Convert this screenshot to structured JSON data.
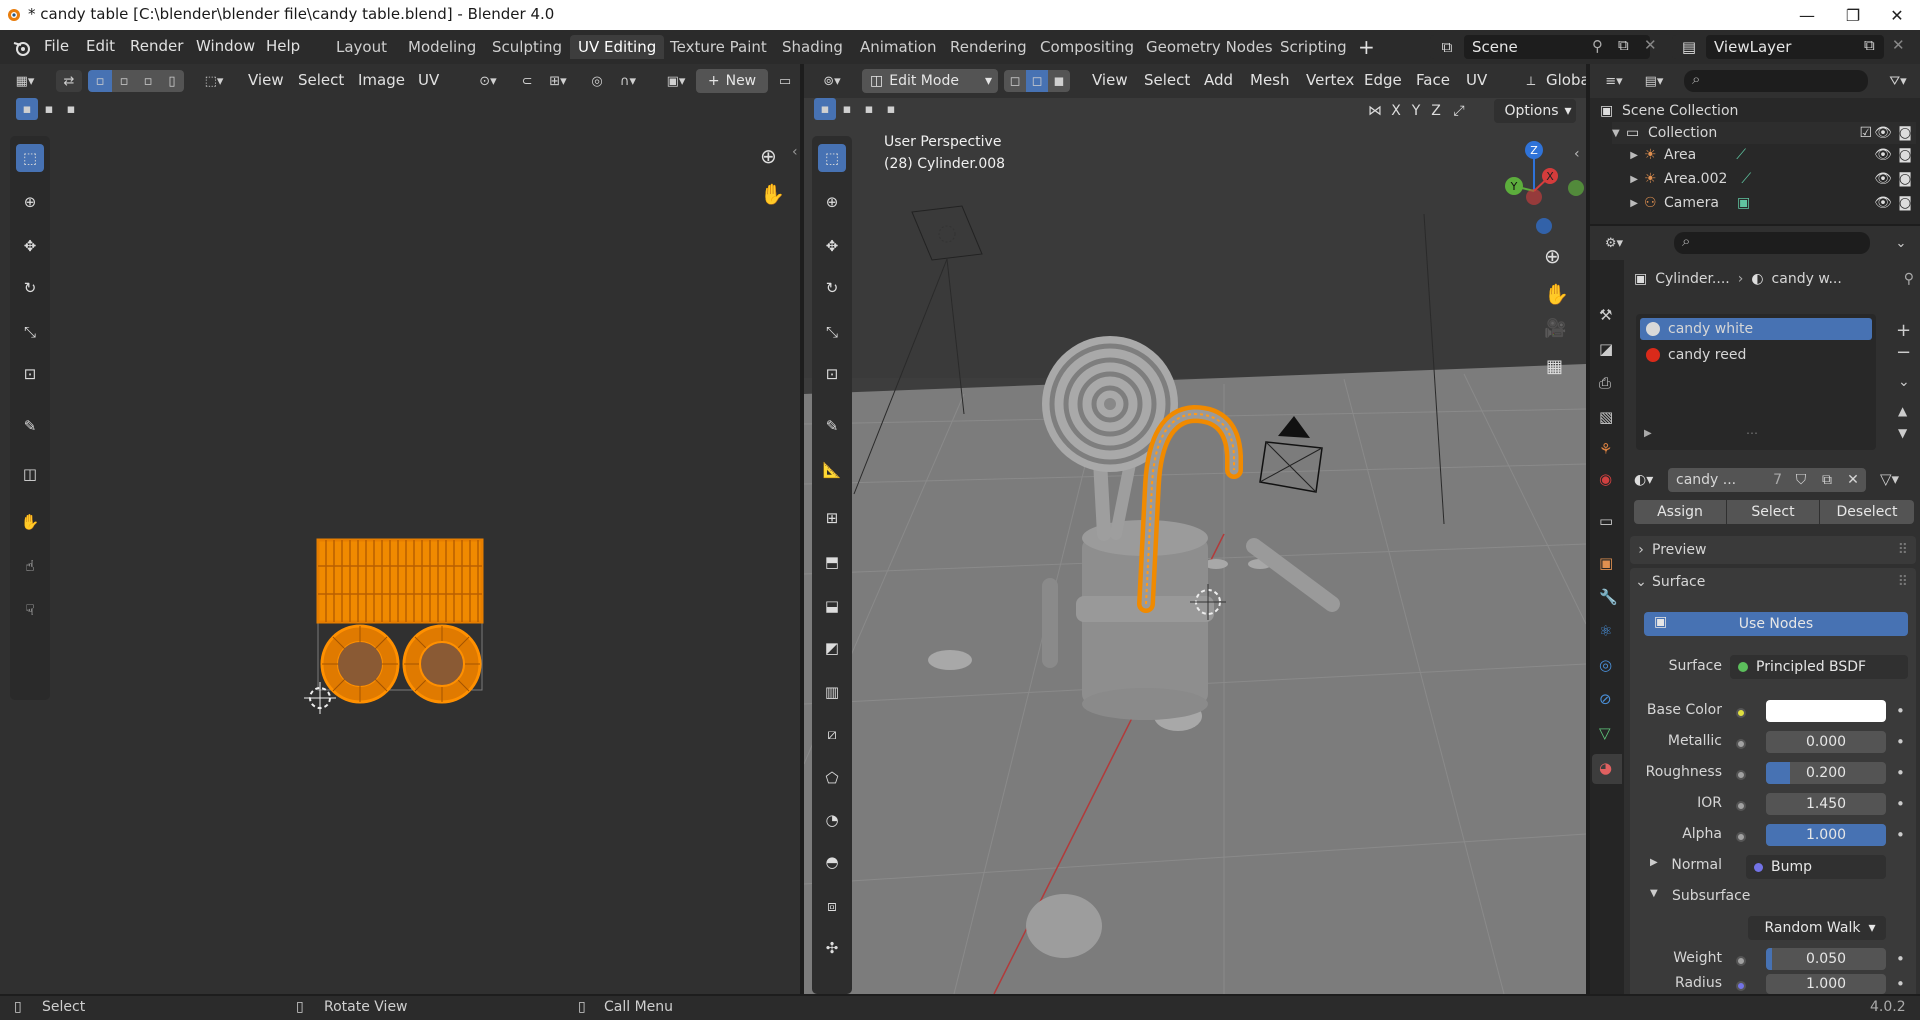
{
  "window": {
    "title": "* candy table [C:\\blender\\blender file\\candy table.blend] - Blender 4.0",
    "minimize": "—",
    "maximize": "❐",
    "close": "✕"
  },
  "menu": [
    "File",
    "Edit",
    "Render",
    "Window",
    "Help"
  ],
  "workspaces": [
    {
      "label": "Layout",
      "active": false
    },
    {
      "label": "Modeling",
      "active": false
    },
    {
      "label": "Sculpting",
      "active": false
    },
    {
      "label": "UV Editing",
      "active": true
    },
    {
      "label": "Texture Paint",
      "active": false
    },
    {
      "label": "Shading",
      "active": false
    },
    {
      "label": "Animation",
      "active": false
    },
    {
      "label": "Rendering",
      "active": false
    },
    {
      "label": "Compositing",
      "active": false
    },
    {
      "label": "Geometry Nodes",
      "active": false
    },
    {
      "label": "Scripting",
      "active": false
    }
  ],
  "add_workspace": "+",
  "scene": {
    "name": "Scene"
  },
  "view_layer": {
    "name": "ViewLayer"
  },
  "uv_editor": {
    "menus": [
      "View",
      "Select",
      "Image",
      "UV"
    ],
    "new_label": "New"
  },
  "viewport": {
    "mode": "Edit Mode",
    "menus": [
      "View",
      "Select",
      "Add",
      "Mesh",
      "Vertex",
      "Edge",
      "Face",
      "UV"
    ],
    "orientation": "Globa",
    "options_label": "Options",
    "axes_lock": [
      "X",
      "Y",
      "Z"
    ],
    "overlay_title": "User Perspective",
    "overlay_object": "(28) Cylinder.008",
    "gizmo": {
      "z": "Z",
      "y": "Y",
      "x": "X"
    }
  },
  "outliner": {
    "root": "Scene Collection",
    "collection": "Collection",
    "items": [
      "Area",
      "Area.002",
      "Camera"
    ]
  },
  "properties": {
    "breadcrumb_object": "Cylinder....",
    "breadcrumb_material": "candy w...",
    "slots": [
      {
        "name": "candy white",
        "color": "#d8d8d8",
        "selected": true
      },
      {
        "name": "candy reed",
        "color": "#d92a1a",
        "selected": false
      }
    ],
    "material_name": "candy ...",
    "users": "7",
    "assign": "Assign",
    "select": "Select",
    "deselect": "Deselect",
    "preview_panel": "Preview",
    "surface_panel": "Surface",
    "use_nodes": "Use Nodes",
    "surface_label": "Surface",
    "surface_value": "Principled BSDF",
    "base_color_label": "Base Color",
    "base_color": "#ffffff",
    "metallic_label": "Metallic",
    "metallic": "0.000",
    "roughness_label": "Roughness",
    "roughness": "0.200",
    "roughness_fraction": 0.2,
    "ior_label": "IOR",
    "ior": "1.450",
    "alpha_label": "Alpha",
    "alpha": "1.000",
    "alpha_fraction": 1.0,
    "normal_label": "Normal",
    "normal_value": "Bump",
    "subsurface_label": "Subsurface",
    "subsurface_method": "Random Walk",
    "weight_label": "Weight",
    "weight": "0.050",
    "weight_fraction": 0.05,
    "radius_label": "Radius",
    "radius": "1.000"
  },
  "statusbar": {
    "select": "Select",
    "rotate": "Rotate View",
    "call_menu": "Call Menu",
    "version": "4.0.2"
  },
  "colors": {
    "accent": "#4772b3",
    "selection_orange": "#ff8c00",
    "panel": "#303030"
  }
}
